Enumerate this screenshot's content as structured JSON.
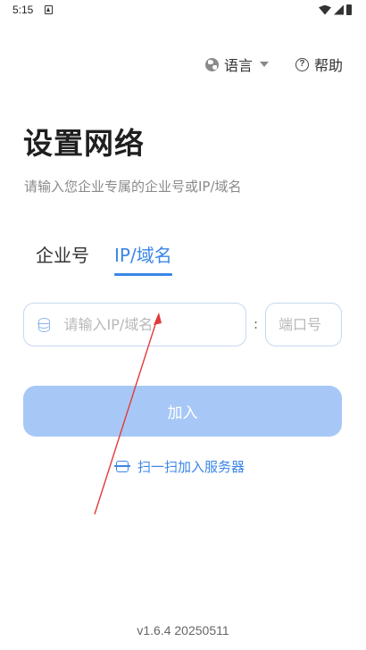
{
  "status_bar": {
    "time": "5:15"
  },
  "header": {
    "language_label": "语言",
    "help_label": "帮助"
  },
  "main": {
    "title": "设置网络",
    "subtitle": "请输入您企业专属的企业号或IP/域名",
    "tabs": [
      {
        "label": "企业号",
        "active": false
      },
      {
        "label": "IP/域名",
        "active": true
      }
    ],
    "host_field": {
      "placeholder": "请输入IP/域名",
      "value": ""
    },
    "separator": ":",
    "port_field": {
      "placeholder": "端口号",
      "value": ""
    },
    "join_button_label": "加入",
    "scan_link_label": "扫一扫加入服务器"
  },
  "footer": {
    "version": "v1.6.4 20250511"
  },
  "colors": {
    "accent": "#3a86e8",
    "button_disabled": "#a7c8f6",
    "annotation": "#e23a3a"
  },
  "icons": [
    "a-icon",
    "wifi-icon",
    "signal-icon",
    "battery-icon",
    "globe-icon",
    "chevron-down-icon",
    "help-icon",
    "database-icon",
    "scan-icon"
  ]
}
